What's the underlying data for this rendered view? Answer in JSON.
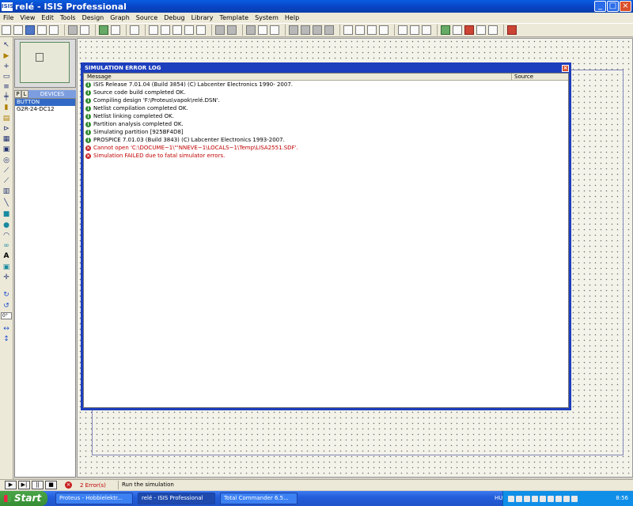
{
  "window": {
    "title": "relé - ISIS Professional",
    "icon_text": "ISIS"
  },
  "menu": [
    "File",
    "View",
    "Edit",
    "Tools",
    "Design",
    "Graph",
    "Source",
    "Debug",
    "Library",
    "Template",
    "System",
    "Help"
  ],
  "devices": {
    "tab_p": "P",
    "tab_l": "L",
    "header": "DEVICES",
    "items": [
      "BUTTON",
      "G2R-24-DC12"
    ]
  },
  "left_tools": {
    "rotation_value": "0°"
  },
  "dialog": {
    "title": "SIMULATION ERROR LOG",
    "columns": [
      "Message",
      "Source"
    ],
    "rows": [
      {
        "type": "info",
        "text": "ISIS Release 7.01.04 (Build 3854) (C) Labcenter Electronics 1990- 2007."
      },
      {
        "type": "info",
        "text": "Source code build completed OK."
      },
      {
        "type": "info",
        "text": "Compiling design 'F:\\Proteus\\vapok\\relé.DSN'."
      },
      {
        "type": "info",
        "text": "Netlist compilation completed OK."
      },
      {
        "type": "info",
        "text": "Netlist linking completed OK."
      },
      {
        "type": "info",
        "text": "Partition analysis completed OK."
      },
      {
        "type": "info",
        "text": "Simulating partition [925BF4D8]"
      },
      {
        "type": "info",
        "text": "PROSPICE 7.01.03 (Build 3843) (C) Labcenter Electronics 1993-2007."
      },
      {
        "type": "error",
        "text": "Cannot open 'C:\\DOCUME~1\\\"'NNEVE~1\\LOCALS~1\\Temp\\LISA2551.SDF'."
      },
      {
        "type": "error",
        "text": "Simulation FAILED due to fatal simulator errors."
      }
    ]
  },
  "status": {
    "errors": "2 Error(s)",
    "message": "Run the simulation"
  },
  "taskbar": {
    "start": "Start",
    "tasks": [
      {
        "label": "Proteus - Hobbielektr...",
        "active": false
      },
      {
        "label": "relé - ISIS Professional",
        "active": true
      },
      {
        "label": "Total Commander 6.5...",
        "active": false
      }
    ],
    "language": "HU",
    "clock": "8:56"
  }
}
